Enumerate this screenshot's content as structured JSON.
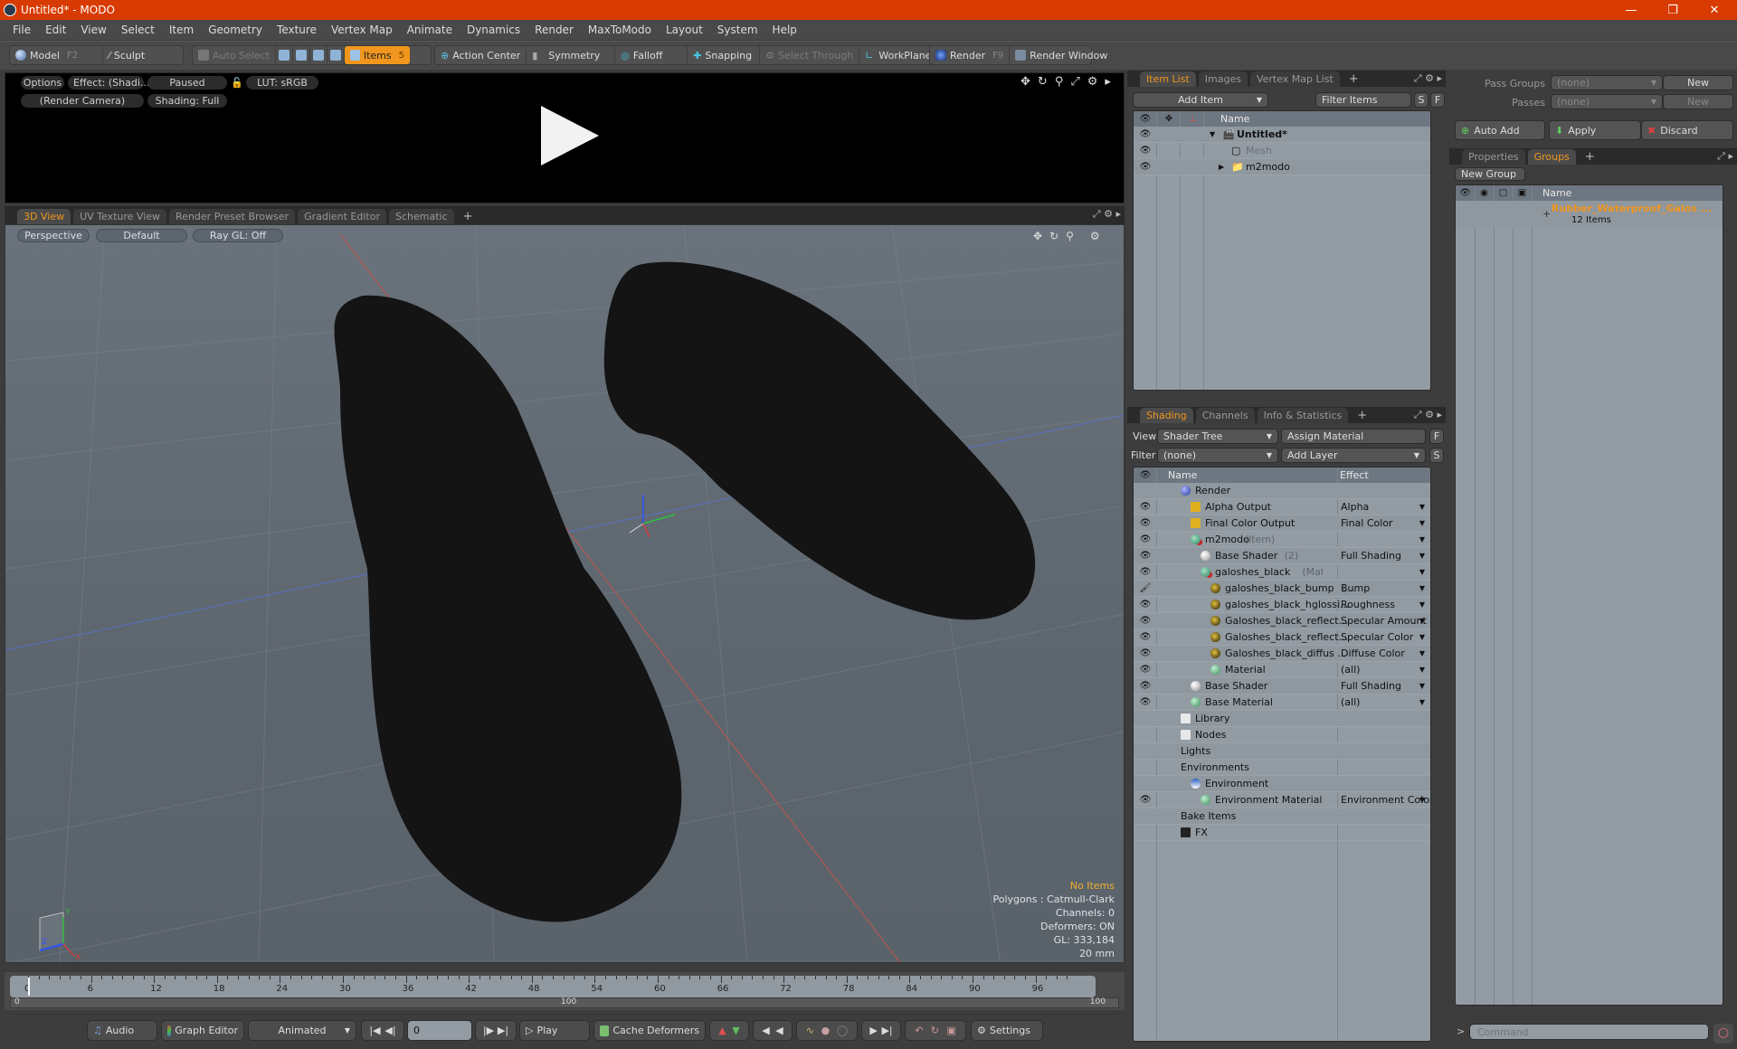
{
  "window": {
    "title": "Untitled* - MODO",
    "controls": [
      "minimize",
      "restore",
      "close"
    ]
  },
  "menu": [
    "File",
    "Edit",
    "View",
    "Select",
    "Item",
    "Geometry",
    "Texture",
    "Vertex Map",
    "Animate",
    "Dynamics",
    "Render",
    "MaxToModo",
    "Layout",
    "System",
    "Help"
  ],
  "toolbar": {
    "model": "Model",
    "model_key": "F2",
    "sculpt": "Sculpt",
    "auto_select": "Auto Select",
    "items": "Items",
    "items_key": "5",
    "action_center": "Action Center",
    "symmetry": "Symmetry",
    "falloff": "Falloff",
    "snapping": "Snapping",
    "select_through": "Select Through",
    "workplane": "WorkPlane",
    "render": "Render",
    "render_key": "F9",
    "render_window": "Render Window"
  },
  "preview": {
    "options": "Options",
    "effect": "Effect: (Shadi...",
    "status": "Paused",
    "lut": "LUT: sRGB",
    "camera": "(Render Camera)",
    "shading": "Shading: Full"
  },
  "viewport": {
    "tabs": [
      "3D View",
      "UV Texture View",
      "Render Preset Browser",
      "Gradient Editor",
      "Schematic"
    ],
    "active_tab": "3D View",
    "projection": "Perspective",
    "style": "Default",
    "raygl": "Ray GL: Off",
    "stats": {
      "selection": "No Items",
      "polygons": "Polygons : Catmull-Clark",
      "channels": "Channels: 0",
      "deformers": "Deformers: ON",
      "gl": "GL: 333,184",
      "grid": "20 mm"
    },
    "axis": {
      "x": "X",
      "y": "Y",
      "z": "Z"
    }
  },
  "timeline": {
    "ticks": [
      "0",
      "6",
      "12",
      "18",
      "24",
      "30",
      "36",
      "42",
      "48",
      "54",
      "60",
      "66",
      "72",
      "78",
      "84",
      "90",
      "96"
    ],
    "range_start": "0",
    "range_mid": "100",
    "range_end": "100",
    "current_frame": 0
  },
  "bottombar": {
    "audio": "Audio",
    "graph_editor": "Graph Editor",
    "mode": "Animated",
    "frame": "0",
    "play": "Play",
    "cache": "Cache Deformers",
    "settings": "Settings"
  },
  "itemlist": {
    "tabs": [
      "Item List",
      "Images",
      "Vertex Map List"
    ],
    "active_tab": "Item List",
    "add_item": "Add Item",
    "filter": "Filter Items",
    "s": "S",
    "f": "F",
    "col_name": "Name",
    "rows": [
      {
        "name": "Untitled*",
        "kind": "scene"
      },
      {
        "name": "Mesh",
        "kind": "mesh"
      },
      {
        "name": "m2modo",
        "kind": "group"
      }
    ]
  },
  "shading": {
    "tabs": [
      "Shading",
      "Channels",
      "Info & Statistics"
    ],
    "active_tab": "Shading",
    "view_label": "View",
    "view_value": "Shader Tree",
    "assign_material": "Assign Material",
    "filter_label": "Filter",
    "filter_value": "(none)",
    "add_layer": "Add Layer",
    "col_name": "Name",
    "col_effect": "Effect",
    "rows": [
      {
        "name": "Render",
        "sub": "",
        "effect": "",
        "indent": 0,
        "eye": false,
        "icon": "render"
      },
      {
        "name": "Alpha Output",
        "sub": "",
        "effect": "Alpha",
        "indent": 1,
        "eye": true,
        "icon": "output"
      },
      {
        "name": "Final Color Output",
        "sub": "",
        "effect": "Final Color",
        "indent": 1,
        "eye": true,
        "icon": "output"
      },
      {
        "name": "m2modo",
        "sub": "(Item)",
        "effect": "",
        "indent": 1,
        "eye": true,
        "icon": "mask"
      },
      {
        "name": "Base Shader",
        "sub": "(2)",
        "effect": "Full Shading",
        "indent": 2,
        "eye": true,
        "icon": "shader"
      },
      {
        "name": "galoshes_black",
        "sub": "(Material)",
        "effect": "",
        "indent": 2,
        "eye": true,
        "icon": "mask"
      },
      {
        "name": "galoshes_black_bump",
        "sub": "(...",
        "effect": "Bump",
        "indent": 3,
        "eye": true,
        "icon": "texture"
      },
      {
        "name": "galoshes_black_hglossi...",
        "sub": "",
        "effect": "Roughness",
        "indent": 3,
        "eye": true,
        "icon": "texture"
      },
      {
        "name": "Galoshes_black_reflect...",
        "sub": "",
        "effect": "Specular Amount",
        "indent": 3,
        "eye": true,
        "icon": "texture"
      },
      {
        "name": "Galoshes_black_reflect...",
        "sub": "",
        "effect": "Specular Color",
        "indent": 3,
        "eye": true,
        "icon": "texture"
      },
      {
        "name": "Galoshes_black_diffus ...",
        "sub": "",
        "effect": "Diffuse Color",
        "indent": 3,
        "eye": true,
        "icon": "texture"
      },
      {
        "name": "Material",
        "sub": "",
        "effect": "(all)",
        "indent": 3,
        "eye": true,
        "icon": "material"
      },
      {
        "name": "Base Shader",
        "sub": "",
        "effect": "Full Shading",
        "indent": 1,
        "eye": true,
        "icon": "shader"
      },
      {
        "name": "Base Material",
        "sub": "",
        "effect": "(all)",
        "indent": 1,
        "eye": true,
        "icon": "material"
      },
      {
        "name": "Library",
        "sub": "",
        "effect": "",
        "indent": 0,
        "eye": false,
        "icon": "folder"
      },
      {
        "name": "Nodes",
        "sub": "",
        "effect": "",
        "indent": 0,
        "eye": false,
        "icon": "folder"
      },
      {
        "name": "Lights",
        "sub": "",
        "effect": "",
        "indent": 0,
        "eye": false,
        "icon": ""
      },
      {
        "name": "Environments",
        "sub": "",
        "effect": "",
        "indent": 0,
        "eye": false,
        "icon": ""
      },
      {
        "name": "Environment",
        "sub": "",
        "effect": "",
        "indent": 1,
        "eye": false,
        "icon": "environment"
      },
      {
        "name": "Environment Material",
        "sub": "",
        "effect": "Environment Color",
        "indent": 2,
        "eye": true,
        "icon": "material"
      },
      {
        "name": "Bake Items",
        "sub": "",
        "effect": "",
        "indent": 0,
        "eye": false,
        "icon": ""
      },
      {
        "name": "FX",
        "sub": "",
        "effect": "",
        "indent": 0,
        "eye": false,
        "icon": "fx"
      }
    ]
  },
  "passes": {
    "pass_groups_label": "Pass Groups",
    "pass_groups_value": "(none)",
    "passes_label": "Passes",
    "passes_value": "(none)",
    "new": "New",
    "auto_add": "Auto Add",
    "apply": "Apply",
    "discard": "Discard"
  },
  "groups": {
    "tabs": [
      "Properties",
      "Groups"
    ],
    "active_tab": "Groups",
    "new_group": "New Group",
    "col_name": "Name",
    "rows": [
      {
        "name": "Rubber_Waterproof_Galos ...",
        "count": "12 Items"
      }
    ]
  },
  "command": {
    "placeholder": "Command",
    "prompt": ">"
  },
  "colors": {
    "titlebar": "#d83b01",
    "accent": "#f0961e"
  }
}
